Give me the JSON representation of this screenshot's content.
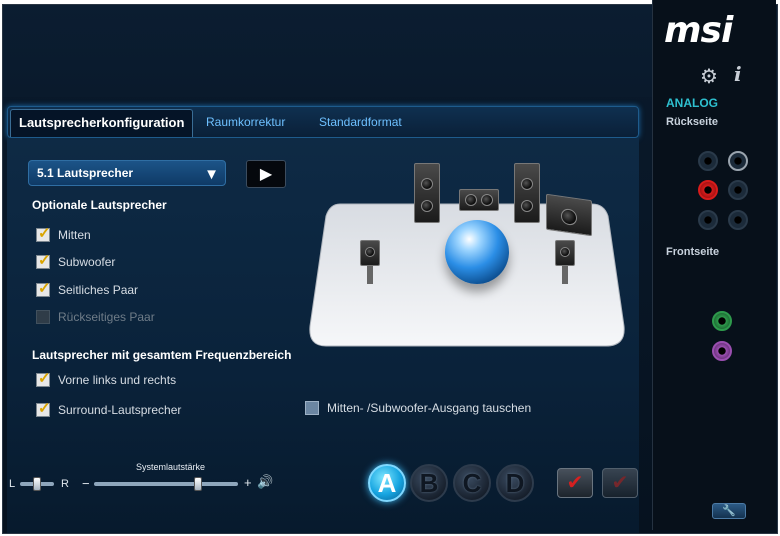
{
  "tabs": [
    "Lautsprecherkonfiguration",
    "Raumkorrektur",
    "Standardformat"
  ],
  "dropdown": {
    "value": "5.1 Lautsprecher"
  },
  "play_icon": "play-icon",
  "optional": {
    "heading": "Optionale Lautsprecher",
    "items": [
      {
        "label": "Mitten",
        "checked": true,
        "enabled": true
      },
      {
        "label": "Subwoofer",
        "checked": true,
        "enabled": true
      },
      {
        "label": "Seitliches Paar",
        "checked": true,
        "enabled": true
      },
      {
        "label": "Rückseitiges Paar",
        "checked": false,
        "enabled": false
      }
    ]
  },
  "fullrange": {
    "heading": "Lautsprecher mit gesamtem Frequenzbereich",
    "items": [
      {
        "label": "Vorne links und rechts",
        "checked": true
      },
      {
        "label": "Surround-Lautsprecher",
        "checked": true
      }
    ]
  },
  "swap": {
    "label": "Mitten- /Subwoofer-Ausgang tauschen",
    "checked": false
  },
  "volume": {
    "label": "Systemlautstärke",
    "balance_left": "L",
    "balance_right": "R",
    "minus": "−",
    "plus": "+",
    "balance_level": 0.5,
    "system_level": 0.72
  },
  "profiles": [
    "A",
    "B",
    "C",
    "D"
  ],
  "active_profile": "A",
  "sidebar": {
    "logo": "msi",
    "analog": "ANALOG",
    "rear": "Rückseite",
    "front": "Frontseite"
  },
  "colors": {
    "accent": "#1aa5e6",
    "analog": "#2ec0d0",
    "jack_red": "#d81b1b",
    "jack_green": "#2e9a4c",
    "jack_purple": "#9a4fb0"
  }
}
